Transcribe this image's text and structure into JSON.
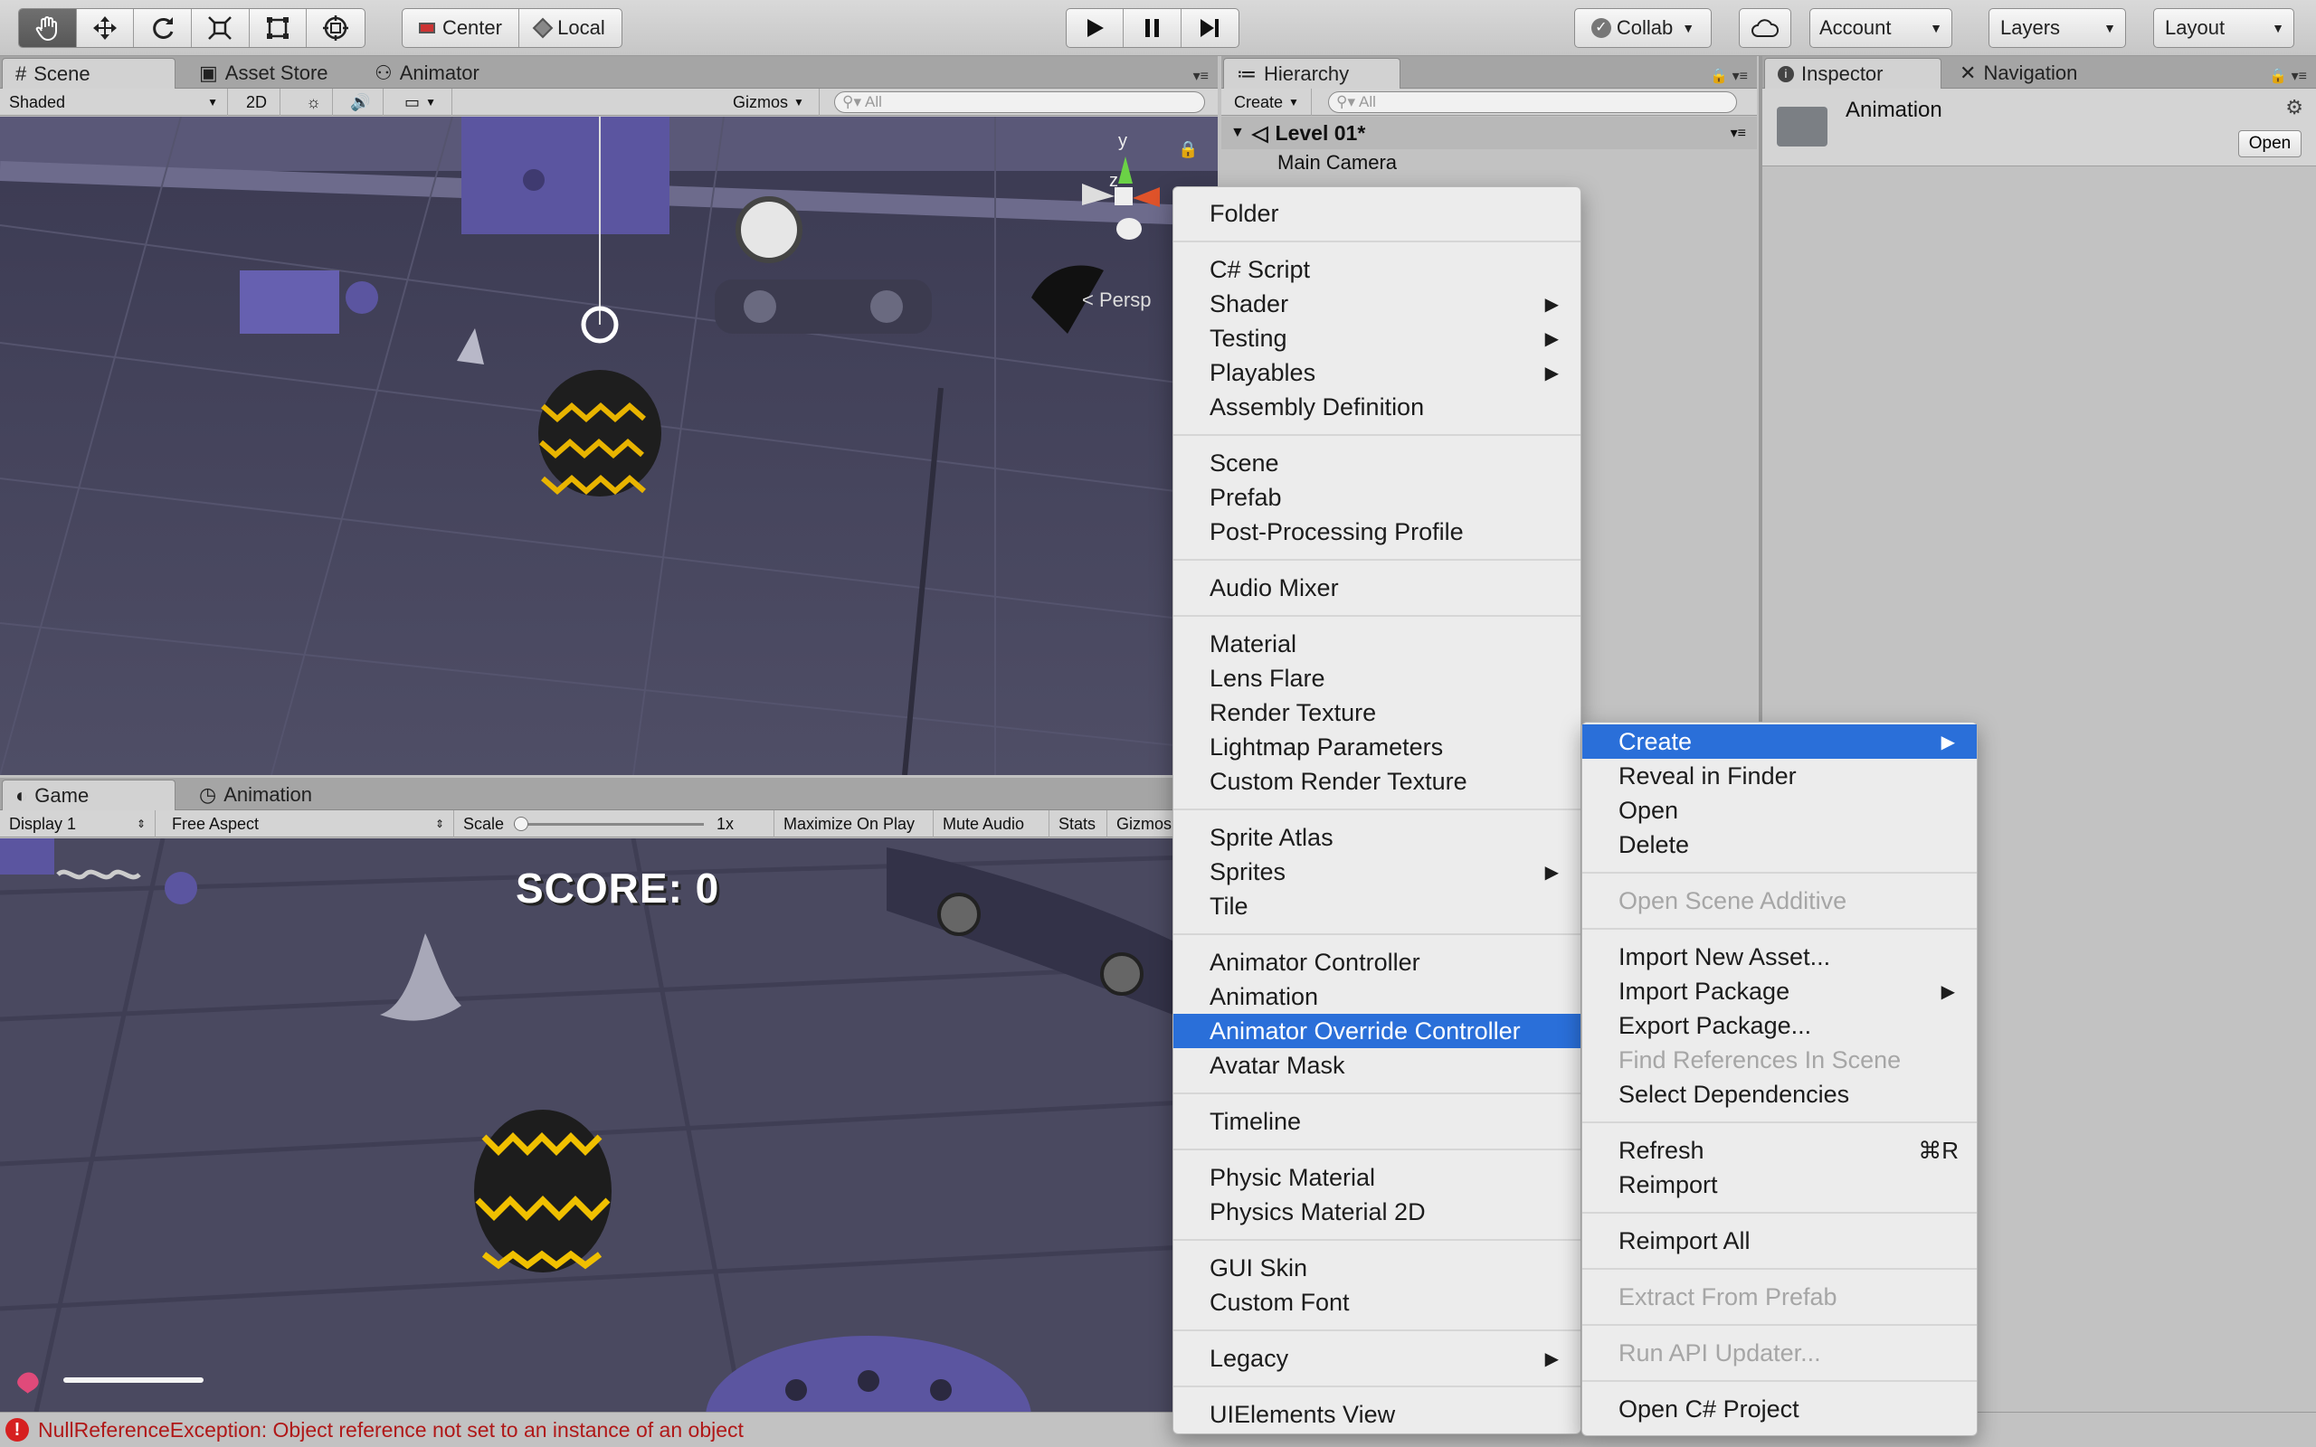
{
  "toolbar": {
    "tools": [
      "hand-tool",
      "move-tool",
      "rotate-tool",
      "scale-tool",
      "rect-tool",
      "transform-tool"
    ],
    "pivot": "Center",
    "space": "Local",
    "collab": "Collab",
    "account": "Account",
    "layers": "Layers",
    "layout": "Layout"
  },
  "scene_panel": {
    "tabs": [
      "Scene",
      "Asset Store",
      "Animator"
    ],
    "shading": "Shaded",
    "mode_2d": "2D",
    "gizmos": "Gizmos",
    "search_placeholder": "All",
    "persp": "Persp",
    "axis_y": "y",
    "axis_z": "z"
  },
  "game_panel": {
    "tabs": [
      "Game",
      "Animation"
    ],
    "display": "Display 1",
    "aspect": "Free Aspect",
    "scale_label": "Scale",
    "scale_value": "1x",
    "maximize": "Maximize On Play",
    "mute": "Mute Audio",
    "stats": "Stats",
    "gizmos": "Gizmos",
    "score": "SCORE: 0"
  },
  "hierarchy": {
    "tab": "Hierarchy",
    "create": "Create",
    "search_placeholder": "All",
    "scene": "Level 01*",
    "items": [
      "Main Camera"
    ]
  },
  "inspector": {
    "tabs": [
      "Inspector",
      "Navigation"
    ],
    "asset_name": "Animation",
    "open_button": "Open"
  },
  "create_menu": {
    "items": [
      {
        "label": "Folder"
      },
      {
        "sep": true
      },
      {
        "label": "C# Script"
      },
      {
        "label": "Shader",
        "submenu": true
      },
      {
        "label": "Testing",
        "submenu": true
      },
      {
        "label": "Playables",
        "submenu": true
      },
      {
        "label": "Assembly Definition"
      },
      {
        "sep": true
      },
      {
        "label": "Scene"
      },
      {
        "label": "Prefab"
      },
      {
        "label": "Post-Processing Profile"
      },
      {
        "sep": true
      },
      {
        "label": "Audio Mixer"
      },
      {
        "sep": true
      },
      {
        "label": "Material"
      },
      {
        "label": "Lens Flare"
      },
      {
        "label": "Render Texture"
      },
      {
        "label": "Lightmap Parameters"
      },
      {
        "label": "Custom Render Texture"
      },
      {
        "sep": true
      },
      {
        "label": "Sprite Atlas"
      },
      {
        "label": "Sprites",
        "submenu": true
      },
      {
        "label": "Tile"
      },
      {
        "sep": true
      },
      {
        "label": "Animator Controller"
      },
      {
        "label": "Animation"
      },
      {
        "label": "Animator Override Controller",
        "highlighted": true
      },
      {
        "label": "Avatar Mask"
      },
      {
        "sep": true
      },
      {
        "label": "Timeline"
      },
      {
        "sep": true
      },
      {
        "label": "Physic Material"
      },
      {
        "label": "Physics Material 2D"
      },
      {
        "sep": true
      },
      {
        "label": "GUI Skin"
      },
      {
        "label": "Custom Font"
      },
      {
        "sep": true
      },
      {
        "label": "Legacy",
        "submenu": true
      },
      {
        "sep": true
      },
      {
        "label": "UIElements View"
      }
    ]
  },
  "context_menu": {
    "items": [
      {
        "label": "Create",
        "submenu": true,
        "highlighted": true
      },
      {
        "label": "Reveal in Finder"
      },
      {
        "label": "Open"
      },
      {
        "label": "Delete"
      },
      {
        "sep": true
      },
      {
        "label": "Open Scene Additive",
        "disabled": true
      },
      {
        "sep": true
      },
      {
        "label": "Import New Asset..."
      },
      {
        "label": "Import Package",
        "submenu": true
      },
      {
        "label": "Export Package..."
      },
      {
        "label": "Find References In Scene",
        "disabled": true
      },
      {
        "label": "Select Dependencies"
      },
      {
        "sep": true
      },
      {
        "label": "Refresh",
        "shortcut": "⌘R"
      },
      {
        "label": "Reimport"
      },
      {
        "sep": true
      },
      {
        "label": "Reimport All"
      },
      {
        "sep": true
      },
      {
        "label": "Extract From Prefab",
        "disabled": true
      },
      {
        "sep": true
      },
      {
        "label": "Run API Updater...",
        "disabled": true
      },
      {
        "sep": true
      },
      {
        "label": "Open C# Project"
      }
    ]
  },
  "status": {
    "message": "NullReferenceException: Object reference not set to an instance of an object"
  },
  "colors": {
    "highlight": "#2a6fd9",
    "scene_floor": "#4a4960",
    "error": "#d62020"
  }
}
